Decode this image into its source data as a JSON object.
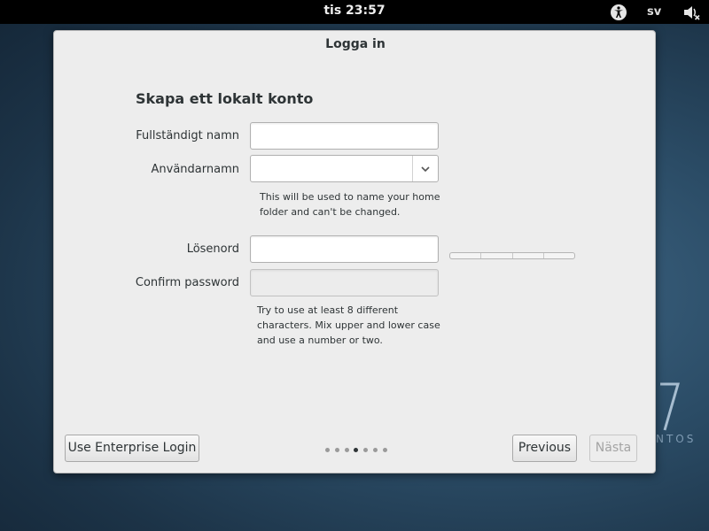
{
  "topbar": {
    "clock": "tis 23:57",
    "language": "sv",
    "icons": [
      "accessibility-icon",
      "volume-muted-icon"
    ]
  },
  "background": {
    "logo_text": "NTOS"
  },
  "dialog": {
    "title": "Logga in",
    "page_title": "Skapa ett lokalt konto",
    "fields": {
      "fullname": {
        "label": "Fullständigt namn",
        "value": ""
      },
      "username": {
        "label": "Användarnamn",
        "value": "",
        "hint": [
          "This will be used to name your home",
          "folder and can't be changed."
        ]
      },
      "password": {
        "label": "Lösenord",
        "value": "",
        "strength_level": 0
      },
      "confirm": {
        "label": "Confirm password",
        "value": ""
      }
    },
    "password_hint": [
      "Try to use at least 8 different",
      "characters. Mix upper and lower case",
      "and use a number or two."
    ],
    "footer": {
      "enterprise_button": "Use Enterprise Login",
      "previous_button": "Previous",
      "next_button": "Nästa",
      "pages_total": 7,
      "current_page": 4
    }
  }
}
